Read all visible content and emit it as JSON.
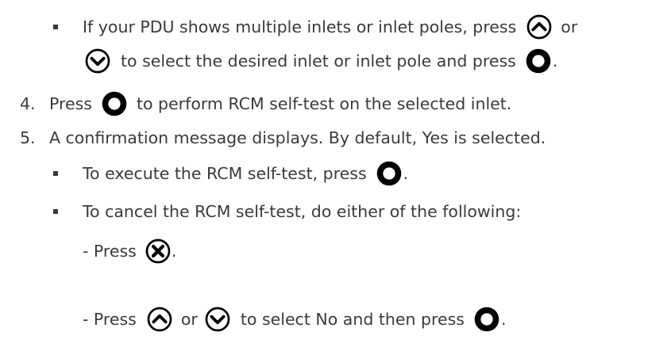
{
  "steps": {
    "sub_inlets": {
      "text1": "If your PDU shows multiple inlets or inlet poles, press",
      "text_or": "or",
      "text2": "to select the desired inlet or inlet pole and press",
      "text_end": "."
    },
    "step4": {
      "number": "4.",
      "text_press": "Press",
      "text_rest": "to perform RCM self-test on the selected inlet."
    },
    "step5": {
      "number": "5.",
      "text": "A confirmation message displays. By default, Yes is selected."
    },
    "sub_execute": {
      "text": "To execute the RCM self-test, press",
      "text_end": "."
    },
    "sub_cancel": {
      "text": "To cancel the RCM self-test, do either of the following:"
    },
    "cancel_opt1": {
      "text": "- Press",
      "text_end": "."
    },
    "cancel_opt2": {
      "text_press": "- Press",
      "text_or": "or",
      "text_rest": "to select No and then press",
      "text_end": "."
    }
  },
  "icons": {
    "up": "up-arrow-button-icon",
    "down": "down-arrow-button-icon",
    "ok": "ok-button-icon",
    "cancel": "cancel-x-button-icon"
  },
  "colors": {
    "text": "#3a3a3a",
    "icon": "#000000"
  }
}
